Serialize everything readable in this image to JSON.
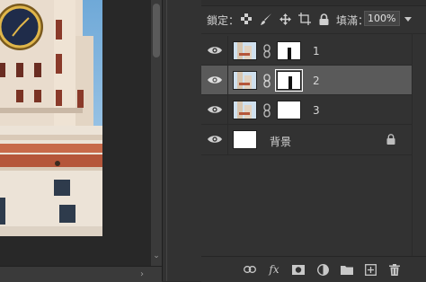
{
  "canvas": {
    "scroll_down_glyph": "⌄",
    "scroll_right_glyph": "›"
  },
  "lock_bar": {
    "lock_label": "鎖定：",
    "lock_icons": [
      "lock-transparent-pixels-icon",
      "lock-image-pixels-icon",
      "lock-position-icon",
      "lock-artboard-icon",
      "lock-all-icon"
    ],
    "fill_label": "填滿：",
    "fill_value": "100%",
    "dropdown_icon": "chevron-down-icon"
  },
  "layers": [
    {
      "name": "1",
      "visible": true,
      "selected": false,
      "has_mask": true,
      "mask_active": false,
      "linked": true
    },
    {
      "name": "2",
      "visible": true,
      "selected": true,
      "has_mask": true,
      "mask_active": true,
      "linked": true
    },
    {
      "name": "3",
      "visible": true,
      "selected": false,
      "has_mask": true,
      "mask_active": false,
      "linked": true
    }
  ],
  "background_layer": {
    "name": "背景",
    "visible": true,
    "locked": true
  },
  "toolbar": {
    "icons": [
      "link-layers-icon",
      "fx-icon",
      "add-mask-icon",
      "adjustment-layer-icon",
      "new-group-icon",
      "new-layer-icon",
      "delete-icon"
    ],
    "fx_label": "fx"
  },
  "colors": {
    "panel_bg": "#323232",
    "selected_row": "#5a5a5a",
    "canvas_bg": "#282828"
  }
}
